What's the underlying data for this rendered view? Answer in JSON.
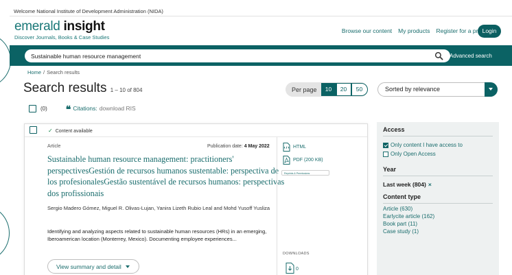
{
  "welcome": "Welcome National Institute of Development Administration (NIDA)",
  "logo": {
    "word1": "emerald",
    "word2": "insight",
    "tagline": "Discover Journals, Books & Case Studies"
  },
  "nav": {
    "browse": "Browse our content",
    "products": "My products",
    "register": "Register for a profile",
    "login": "Login"
  },
  "search": {
    "value": "Sustainable human resource management",
    "advanced": "Advanced search"
  },
  "breadcrumb": {
    "home": "Home",
    "separator": "/",
    "current": "Search results"
  },
  "results": {
    "title": "Search results",
    "range": "1 – 10 of 804"
  },
  "perpage": {
    "label": "Per page",
    "options": [
      "10",
      "20",
      "50"
    ],
    "selected": "10"
  },
  "sort": {
    "value": "Sorted by relevance"
  },
  "selection": {
    "count": "(0)",
    "citations_label": "Citations:",
    "citations_action": "download RIS"
  },
  "result": {
    "availability": "Content available",
    "type": "Article",
    "pub_label": "Publication date:",
    "pub_date": "4 May 2022",
    "title": "Sustainable human resource management: practitioners' perspectivesGestión de recursos humanos sustentable: perspectiva de los profesionalesGestão sustentável de recursos humanos: perspectivas dos profissionais",
    "authors": "Sergio Madero Gómez, Miguel R. Olivas-Lujan, Yanira Lizeth Rubio Leal and Mohd Yusoff Yusliza",
    "abstract": "Identifying and analyzing aspects related to sustainable human resources (HRs) in an emerging, Iberoamerican location (Monterrey, Mexico). Documenting employee experiences...",
    "summary_btn": "View summary and detail",
    "formats": {
      "html": "HTML",
      "pdf": "PDF (200 KB)"
    },
    "reprints": "Reprints & Permissions",
    "downloads_label": "DOWNLOADS",
    "downloads_count": "0"
  },
  "filters": {
    "access": {
      "heading": "Access",
      "options": [
        {
          "label": "Only content I have access to",
          "checked": true
        },
        {
          "label": "Only Open Access",
          "checked": false
        }
      ]
    },
    "year": {
      "heading": "Year",
      "value": "Last week (804)",
      "remove": "×"
    },
    "content_type": {
      "heading": "Content type",
      "items": [
        "Article (630)",
        "Earlycite article (162)",
        "Book part (11)",
        "Case study (1)"
      ]
    }
  },
  "colors": {
    "brand": "#0b6264",
    "link": "#1a6d6d",
    "panel": "#eef1f1",
    "available": "#1b8a4e"
  }
}
